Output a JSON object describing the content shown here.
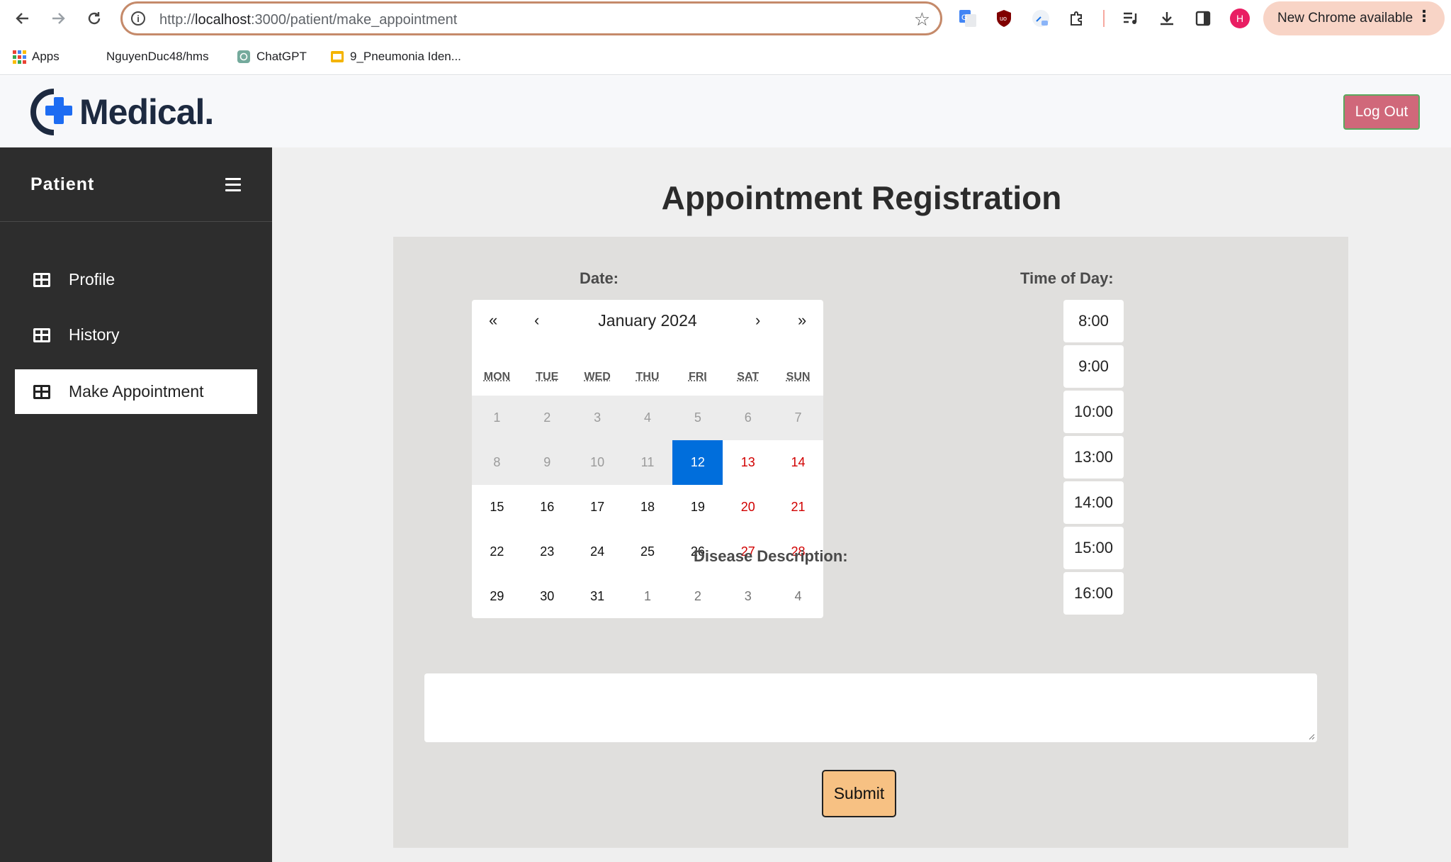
{
  "browser": {
    "url_prefix": "http://",
    "url_host": "localhost",
    "url_rest": ":3000/patient/make_appointment",
    "profile_initial": "H",
    "update_label": "New Chrome available",
    "bookmarks": [
      {
        "label": "Apps",
        "icon": "apps-grid-icon"
      },
      {
        "label": "NguyenDuc48/hms",
        "icon": "github-icon"
      },
      {
        "label": "ChatGPT",
        "icon": "chatgpt-icon"
      },
      {
        "label": "9_Pneumonia Iden...",
        "icon": "slides-icon"
      }
    ]
  },
  "header": {
    "logo_text": "Medical.",
    "logout_label": "Log Out"
  },
  "sidebar": {
    "title": "Patient",
    "items": [
      {
        "label": "Profile",
        "icon": "table-icon",
        "active": false
      },
      {
        "label": "History",
        "icon": "table-icon",
        "active": false
      },
      {
        "label": "Make Appointment",
        "icon": "table-icon",
        "active": true
      }
    ]
  },
  "main": {
    "title": "Appointment Registration",
    "date_label": "Date:",
    "time_label": "Time of Day:",
    "description_label": "Disease Description:",
    "description_value": "",
    "submit_label": "Submit"
  },
  "calendar": {
    "month_label": "January 2024",
    "nav": {
      "prev_year": "«",
      "prev_month": "‹",
      "next_month": "›",
      "next_year": "»"
    },
    "weekdays": [
      "MON",
      "TUE",
      "WED",
      "THU",
      "FRI",
      "SAT",
      "SUN"
    ],
    "weeks": [
      [
        "1",
        "2",
        "3",
        "4",
        "5",
        "6",
        "7"
      ],
      [
        "8",
        "9",
        "10",
        "11",
        "12",
        "13",
        "14"
      ],
      [
        "15",
        "16",
        "17",
        "18",
        "19",
        "20",
        "21"
      ],
      [
        "22",
        "23",
        "24",
        "25",
        "26",
        "27",
        "28"
      ],
      [
        "29",
        "30",
        "31",
        "1",
        "2",
        "3",
        "4"
      ]
    ],
    "selected": "12",
    "disabled_through": "11",
    "colors": {
      "selected": "#006edc",
      "weekend": "#d10000"
    }
  },
  "time_slots": [
    "8:00",
    "9:00",
    "10:00",
    "13:00",
    "14:00",
    "15:00",
    "16:00"
  ]
}
